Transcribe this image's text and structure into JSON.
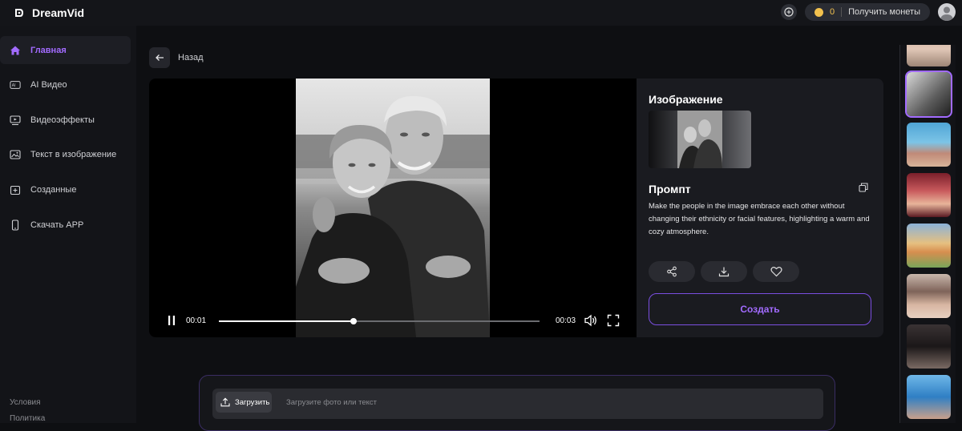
{
  "app": {
    "name": "DreamVid"
  },
  "header": {
    "coin_count": "0",
    "coin_label": "Получить монеты"
  },
  "sidebar": {
    "items": [
      {
        "label": "Главная",
        "icon": "home-icon"
      },
      {
        "label": "AI Видео",
        "icon": "ai-video-icon"
      },
      {
        "label": "Видеоэффекты",
        "icon": "video-effects-icon"
      },
      {
        "label": "Текст в изображение",
        "icon": "text-to-image-icon"
      },
      {
        "label": "Созданные",
        "icon": "created-icon"
      },
      {
        "label": "Скачать APP",
        "icon": "phone-icon"
      }
    ],
    "footer": [
      "Условия",
      "Политика"
    ]
  },
  "nav": {
    "back_label": "Назад"
  },
  "player": {
    "current_time": "00:01",
    "total_time": "00:03",
    "progress": 0.42
  },
  "details": {
    "image_title": "Изображение",
    "prompt_title": "Промпт",
    "prompt_text": "Make the people in the image embrace each other without changing their ethnicity or facial features, highlighting a warm and cozy atmosphere.",
    "create_label": "Создать"
  },
  "composer": {
    "upload_label": "Загрузить",
    "placeholder": "Загрузите фото или текст"
  },
  "colors": {
    "accent": "#a26bff",
    "coin": "#f2c14e",
    "background": "#0e0f12"
  }
}
